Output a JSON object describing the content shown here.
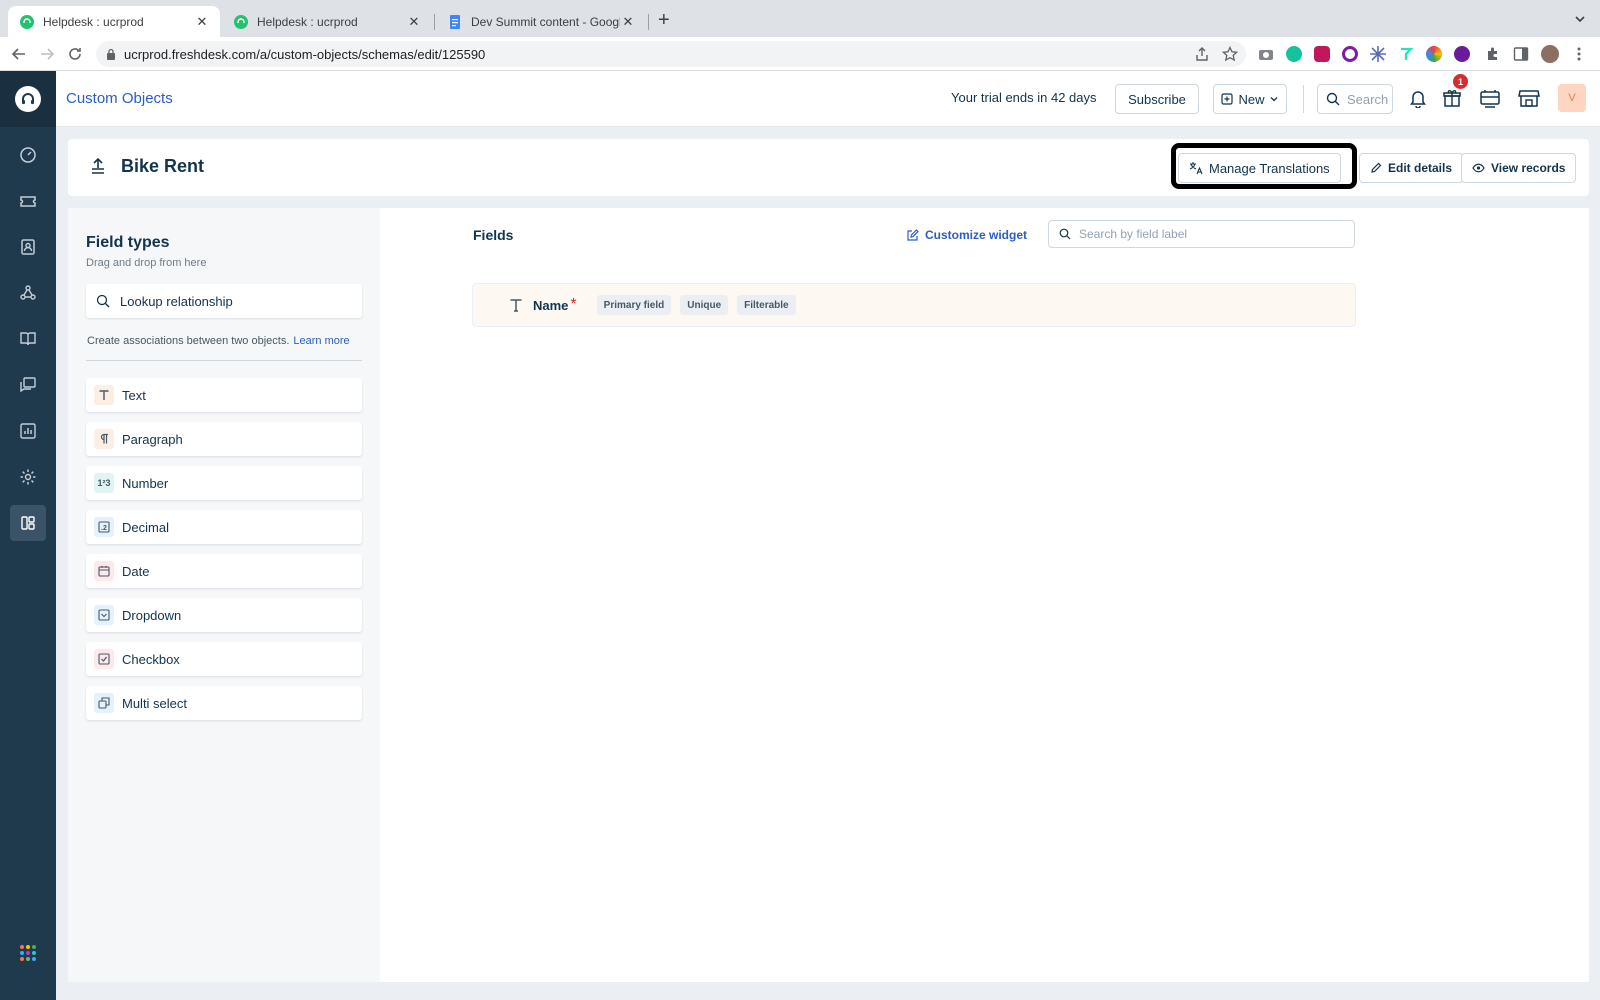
{
  "browser": {
    "tabs": [
      {
        "label": "Helpdesk : ucrprod",
        "active": true,
        "icon": "freshdesk-favicon"
      },
      {
        "label": "Helpdesk : ucrprod",
        "active": false,
        "icon": "freshdesk-favicon"
      },
      {
        "label": "Dev Summit content - Google S",
        "active": false,
        "icon": "google-docs-favicon"
      }
    ],
    "url": "ucrprod.freshdesk.com/a/custom-objects/schemas/edit/125590"
  },
  "header": {
    "title": "Custom Objects",
    "trial_text": "Your trial ends in 42 days",
    "subscribe_label": "Subscribe",
    "new_label": "New",
    "search_placeholder": "Search",
    "notification_count": "1",
    "avatar_initial": "V"
  },
  "page": {
    "title": "Bike Rent",
    "manage_translations_label": "Manage Translations",
    "edit_details_label": "Edit details",
    "view_records_label": "View records"
  },
  "field_types": {
    "title": "Field types",
    "subtitle": "Drag and drop from here",
    "lookup_label": "Lookup relationship",
    "assoc_text": "Create associations between two objects.",
    "learn_more": "Learn more",
    "items": [
      {
        "label": "Text",
        "icon": "text-type-icon"
      },
      {
        "label": "Paragraph",
        "icon": "paragraph-icon"
      },
      {
        "label": "Number",
        "icon": "number-icon"
      },
      {
        "label": "Decimal",
        "icon": "decimal-icon"
      },
      {
        "label": "Date",
        "icon": "calendar-icon"
      },
      {
        "label": "Dropdown",
        "icon": "dropdown-icon"
      },
      {
        "label": "Checkbox",
        "icon": "checkbox-icon"
      },
      {
        "label": "Multi select",
        "icon": "multi-select-icon"
      }
    ]
  },
  "fields": {
    "title": "Fields",
    "customize_label": "Customize widget",
    "search_placeholder": "Search by field label",
    "rows": [
      {
        "name": "Name",
        "required": "*",
        "tags": [
          "Primary field",
          "Unique",
          "Filterable"
        ]
      }
    ]
  },
  "colors": {
    "accent": "#2c5cc5",
    "sidebar": "#1f3a4d",
    "required": "#d72d30"
  }
}
